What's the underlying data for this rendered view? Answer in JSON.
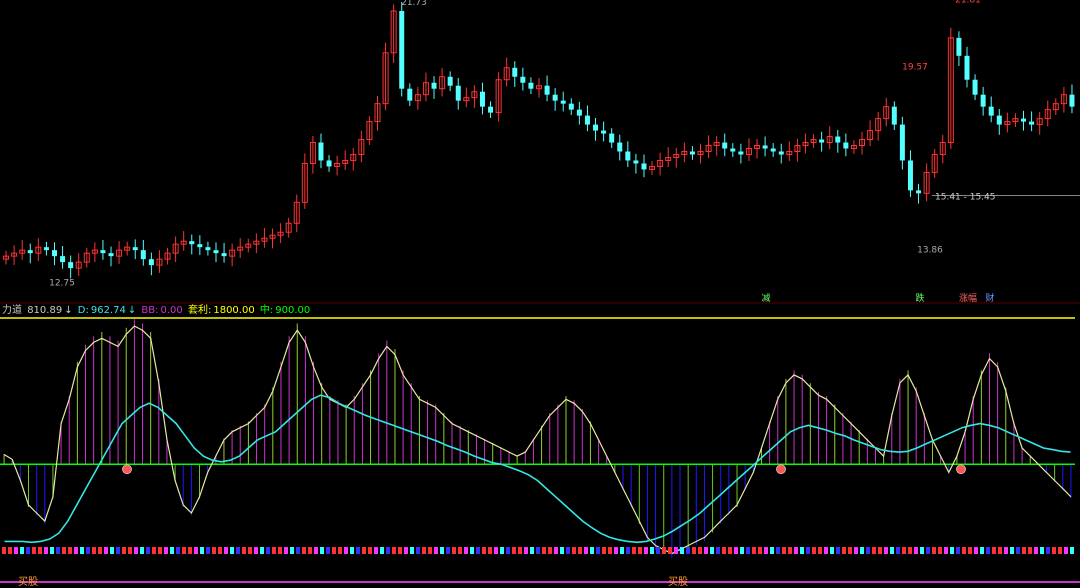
{
  "chart_data": [
    {
      "type": "candlestick",
      "title": "",
      "price_annotations": [
        {
          "label": "12.75",
          "value": 12.75
        },
        {
          "label": "19.57",
          "value": 19.57
        },
        {
          "label": "21.81",
          "value": 21.81
        },
        {
          "label": "13.86",
          "value": 13.86
        },
        {
          "label": "21.73",
          "value": 21.73
        }
      ],
      "range_label": "15.41 - 15.45",
      "range_value": 15.43,
      "event_labels": [
        "减",
        "跌",
        "涨幅",
        "财"
      ],
      "ylim": [
        12.0,
        21.9
      ],
      "closes": [
        13.4,
        13.5,
        13.6,
        13.5,
        13.7,
        13.6,
        13.4,
        13.2,
        13.0,
        13.2,
        13.5,
        13.6,
        13.5,
        13.4,
        13.6,
        13.7,
        13.6,
        13.3,
        13.1,
        13.3,
        13.5,
        13.8,
        13.9,
        13.8,
        13.7,
        13.6,
        13.5,
        13.4,
        13.6,
        13.7,
        13.8,
        13.9,
        14.0,
        14.1,
        14.2,
        14.5,
        15.2,
        16.5,
        17.2,
        16.6,
        16.4,
        16.5,
        16.6,
        16.8,
        17.3,
        17.9,
        18.5,
        20.2,
        21.6,
        19.0,
        18.6,
        18.8,
        19.2,
        19.0,
        19.4,
        19.1,
        18.6,
        18.7,
        18.9,
        18.4,
        18.2,
        19.3,
        19.7,
        19.4,
        19.2,
        19.0,
        19.1,
        18.8,
        18.6,
        18.5,
        18.3,
        18.1,
        17.8,
        17.6,
        17.5,
        17.2,
        16.9,
        16.6,
        16.5,
        16.3,
        16.4,
        16.6,
        16.7,
        16.8,
        16.9,
        16.8,
        16.9,
        17.1,
        17.2,
        17.0,
        16.9,
        16.8,
        17.0,
        17.1,
        17.0,
        16.9,
        16.8,
        16.9,
        17.1,
        17.2,
        17.3,
        17.2,
        17.4,
        17.2,
        17.0,
        17.1,
        17.3,
        17.6,
        18.0,
        18.4,
        17.8,
        16.6,
        15.6,
        15.5,
        16.2,
        16.8,
        17.2,
        20.7,
        20.1,
        19.3,
        18.8,
        18.4,
        18.1,
        17.8,
        17.9,
        18.0,
        17.9,
        17.8,
        18.0,
        18.3,
        18.5,
        18.8,
        18.4
      ],
      "indicator": {
        "name": "力道",
        "value": 810.89,
        "d": 962.74,
        "bb": 0.0,
        "arbitrage": 1800.0,
        "mid": 900.0,
        "ylim": [
          -1400,
          1800
        ],
        "series": [
          120,
          60,
          -200,
          -500,
          -600,
          -700,
          -400,
          500,
          800,
          1200,
          1400,
          1500,
          1550,
          1500,
          1450,
          1600,
          1700,
          1650,
          1550,
          1000,
          300,
          -200,
          -500,
          -600,
          -400,
          -100,
          100,
          300,
          400,
          450,
          500,
          600,
          700,
          900,
          1200,
          1500,
          1650,
          1500,
          1200,
          950,
          800,
          750,
          700,
          800,
          950,
          1100,
          1300,
          1450,
          1350,
          1100,
          950,
          800,
          750,
          700,
          600,
          500,
          450,
          400,
          350,
          300,
          250,
          200,
          150,
          100,
          150,
          300,
          450,
          600,
          700,
          800,
          750,
          650,
          500,
          300,
          100,
          -100,
          -300,
          -500,
          -700,
          -900,
          -1000,
          -1050,
          -1100,
          -1050,
          -1000,
          -950,
          -900,
          -800,
          -700,
          -600,
          -500,
          -300,
          -100,
          200,
          500,
          800,
          1000,
          1100,
          1050,
          950,
          850,
          800,
          700,
          600,
          500,
          400,
          300,
          200,
          100,
          600,
          1000,
          1100,
          900,
          600,
          300,
          100,
          -100,
          100,
          400,
          800,
          1100,
          1300,
          1200,
          900,
          500,
          200,
          100,
          0,
          -100,
          -200,
          -300,
          -400
        ],
        "d_series": [
          -950,
          -950,
          -950,
          -960,
          -950,
          -920,
          -850,
          -700,
          -500,
          -300,
          -100,
          100,
          300,
          500,
          600,
          700,
          750,
          700,
          600,
          500,
          350,
          200,
          100,
          50,
          30,
          50,
          100,
          200,
          300,
          350,
          400,
          500,
          600,
          700,
          800,
          850,
          820,
          750,
          700,
          650,
          600,
          560,
          520,
          480,
          440,
          400,
          360,
          320,
          280,
          230,
          190,
          150,
          100,
          60,
          20,
          0,
          -40,
          -80,
          -130,
          -200,
          -300,
          -400,
          -500,
          -600,
          -700,
          -780,
          -850,
          -900,
          -930,
          -950,
          -960,
          -950,
          -920,
          -880,
          -820,
          -750,
          -680,
          -600,
          -500,
          -400,
          -300,
          -200,
          -100,
          0,
          100,
          200,
          300,
          400,
          450,
          480,
          450,
          420,
          380,
          350,
          300,
          260,
          220,
          180,
          160,
          150,
          160,
          200,
          250,
          300,
          350,
          400,
          450,
          480,
          500,
          480,
          450,
          400,
          350,
          300,
          250,
          200,
          180,
          160,
          150
        ],
        "markers": [
          "买股",
          "买股"
        ]
      }
    }
  ],
  "colors": {
    "up": "#ff3333",
    "down": "#54ffff",
    "zero_line": "#00ff00",
    "top_line": "#ffff00",
    "bottom_line": "#cc33cc",
    "d_line": "#33e6e6",
    "main_line": "#e8e8a0",
    "hist_pos": "#cc33cc",
    "hist_pos2": "#99cc33",
    "hist_neg": "#1a1aff",
    "hist_neg2": "#66cc33"
  }
}
